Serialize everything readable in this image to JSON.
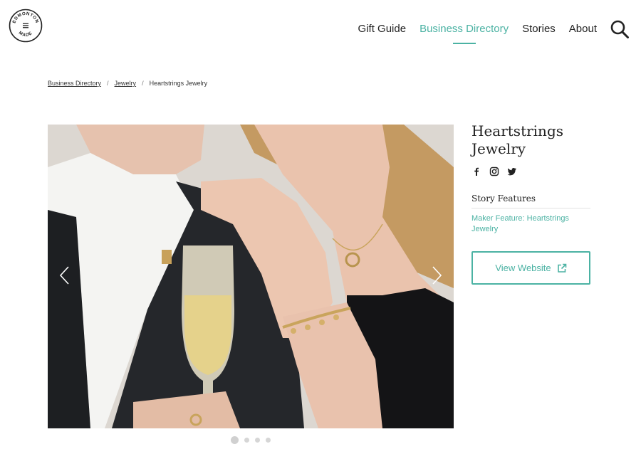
{
  "header": {
    "logo": {
      "top": "EDMONTON",
      "bottom": "MADE",
      "icon": "edmonton-made-logo"
    },
    "nav": [
      {
        "label": "Gift Guide",
        "active": false
      },
      {
        "label": "Business Directory",
        "active": true
      },
      {
        "label": "Stories",
        "active": false
      },
      {
        "label": "About",
        "active": false
      }
    ],
    "search_icon": "search-icon"
  },
  "breadcrumb": {
    "items": [
      "Business Directory",
      "Jewelry"
    ],
    "current": "Heartstrings Jewelry",
    "separator": "/"
  },
  "carousel": {
    "slide_count": 4,
    "active_index": 0,
    "prev_icon": "chevron-left-icon",
    "next_icon": "chevron-right-icon"
  },
  "business": {
    "name_line1": "Heartstrings",
    "name_line2": "Jewelry",
    "socials": [
      "facebook-icon",
      "instagram-icon",
      "twitter-icon"
    ],
    "features_title": "Story Features",
    "feature_link": "Maker Feature: Heartstrings Jewelry",
    "website_button": "View Website",
    "website_icon": "external-link-icon"
  },
  "colors": {
    "accent": "#4bb2a3",
    "text": "#222222"
  }
}
